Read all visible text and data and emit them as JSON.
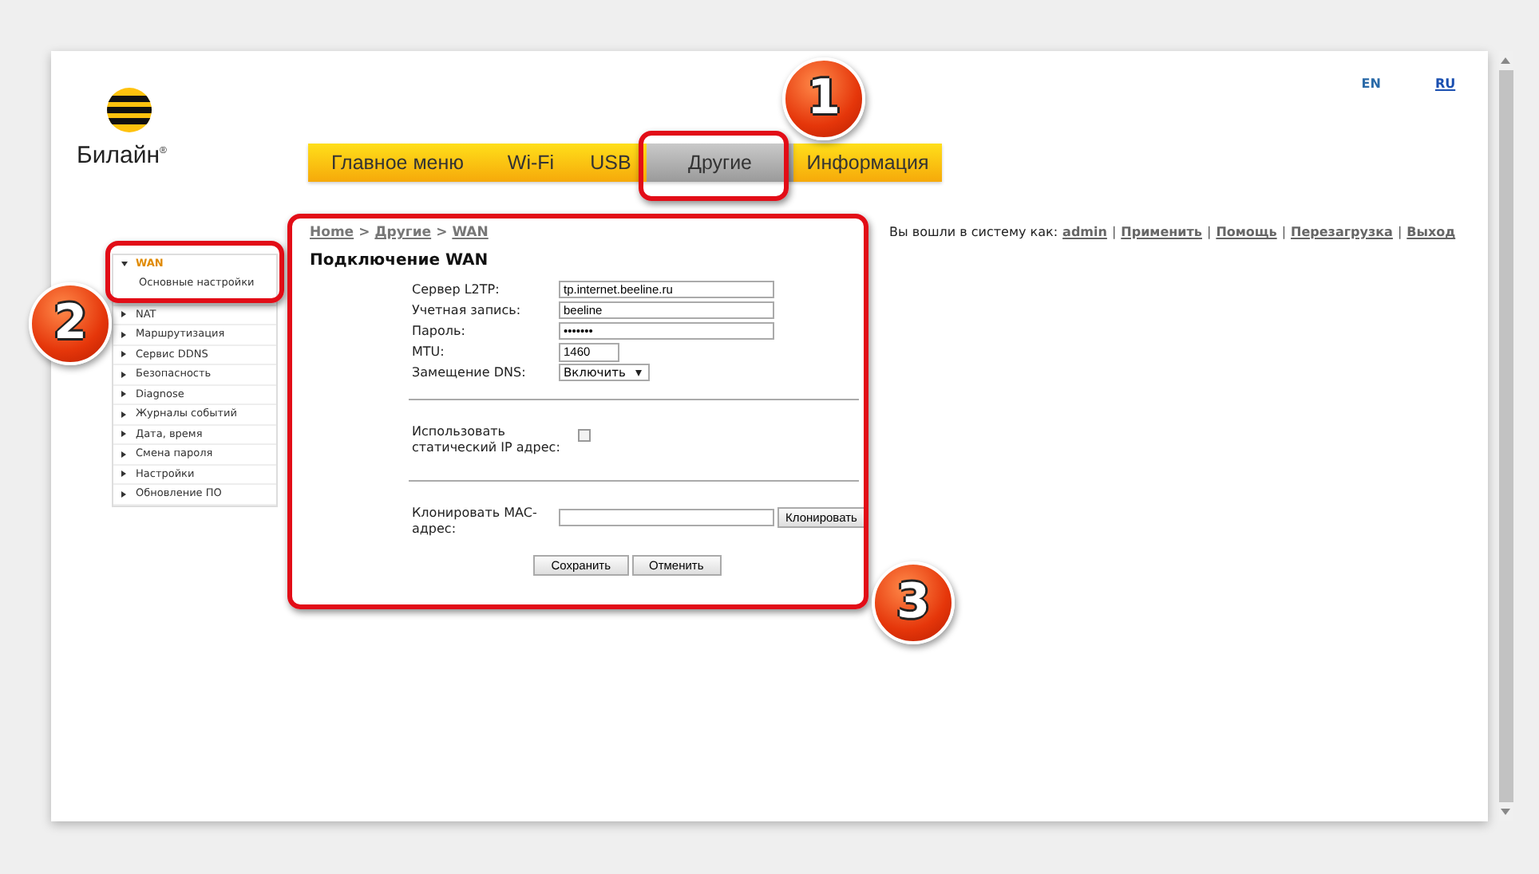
{
  "brand": {
    "name": "Билайн",
    "mark": "®"
  },
  "languages": [
    {
      "label": "EN",
      "selected": true
    },
    {
      "label": "RU",
      "selected": false
    }
  ],
  "tabs": [
    {
      "label": "Главное меню",
      "selected": false
    },
    {
      "label": "Wi-Fi",
      "selected": false
    },
    {
      "label": "USB",
      "selected": false
    },
    {
      "label": "Другие",
      "selected": true
    },
    {
      "label": "Информация",
      "selected": false
    }
  ],
  "breadcrumb": {
    "items": [
      "Home",
      "Другие",
      "WAN"
    ],
    "separator": ">"
  },
  "user_bar": {
    "text": "Вы вошли в систему как:",
    "links": [
      "admin",
      "Применить",
      "Помощь",
      "Перезагрузка",
      "Выход"
    ],
    "separator": "|"
  },
  "sidebar": {
    "items": [
      {
        "label": "WAN",
        "expanded": true,
        "children": [
          {
            "label": "Основные настройки"
          }
        ]
      },
      {
        "label": "NAT",
        "expanded": false
      },
      {
        "label": "Маршрутизация",
        "expanded": false
      },
      {
        "label": "Сервис DDNS",
        "expanded": false
      },
      {
        "label": "Безопасность",
        "expanded": false
      },
      {
        "label": "Diagnose",
        "expanded": false
      },
      {
        "label": "Журналы событий",
        "expanded": false
      },
      {
        "label": "Дата, время",
        "expanded": false
      },
      {
        "label": "Смена пароля",
        "expanded": false
      },
      {
        "label": "Настройки",
        "expanded": false
      },
      {
        "label": "Обновление ПО",
        "expanded": false
      }
    ]
  },
  "form": {
    "title": "Подключение WAN",
    "fields": [
      {
        "kind": "text",
        "label": "Сервер L2TP:",
        "value": "tp.internet.beeline.ru"
      },
      {
        "kind": "text",
        "label": "Учетная запись:",
        "value": "beeline"
      },
      {
        "kind": "text",
        "label": "Пароль:",
        "value": "•••••••"
      },
      {
        "kind": "short",
        "label": "MTU:",
        "value": "1460"
      },
      {
        "kind": "select",
        "label": "Замещение DNS:",
        "value": "Включить"
      }
    ],
    "static_ip": {
      "label": "Использовать статический IP адрес:",
      "checked": false
    },
    "mac_clone": {
      "label": "Клонировать MAC-адрес:",
      "button": "Клонировать"
    },
    "buttons": [
      "Сохранить",
      "Отменить"
    ]
  },
  "annotations": [
    {
      "number": "1"
    },
    {
      "number": "2"
    },
    {
      "number": "3"
    }
  ]
}
